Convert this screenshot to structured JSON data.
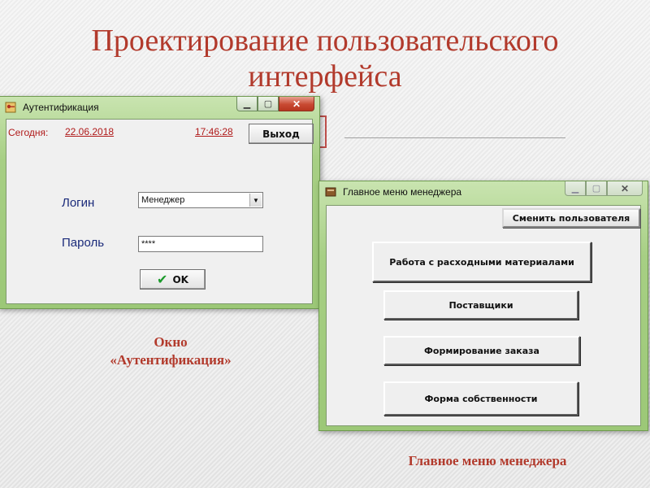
{
  "slide": {
    "title": "Проектирование пользовательского интерфейса",
    "caption_auth_line1": "Окно",
    "caption_auth_line2": "«Аутентификация»",
    "caption_main": "Главное меню менеджера"
  },
  "auth_window": {
    "title": "Аутентификация",
    "today_label": "Сегодня:",
    "date": "22.06.2018",
    "time": "17:46:28",
    "exit_button": "Выход",
    "login_label": "Логин",
    "login_value": "Менеджер",
    "password_label": "Пароль",
    "password_value": "****",
    "ok_button": "OK"
  },
  "main_window": {
    "title": "Главное меню менеджера",
    "change_user_button": "Сменить пользователя",
    "buttons": [
      "Работа с расходными материалами",
      "Поставщики",
      "Формирование заказа",
      "Форма собственности"
    ]
  },
  "colors": {
    "title": "#b23a2c",
    "window_frame": "#a7cf84",
    "date_text": "#b01a1a",
    "field_label": "#1a2a7a",
    "ok_check": "#1a9a2a"
  },
  "icons": {
    "auth_app_icon": "key-icon",
    "main_app_icon": "form-icon",
    "ok_icon": "check-icon"
  }
}
